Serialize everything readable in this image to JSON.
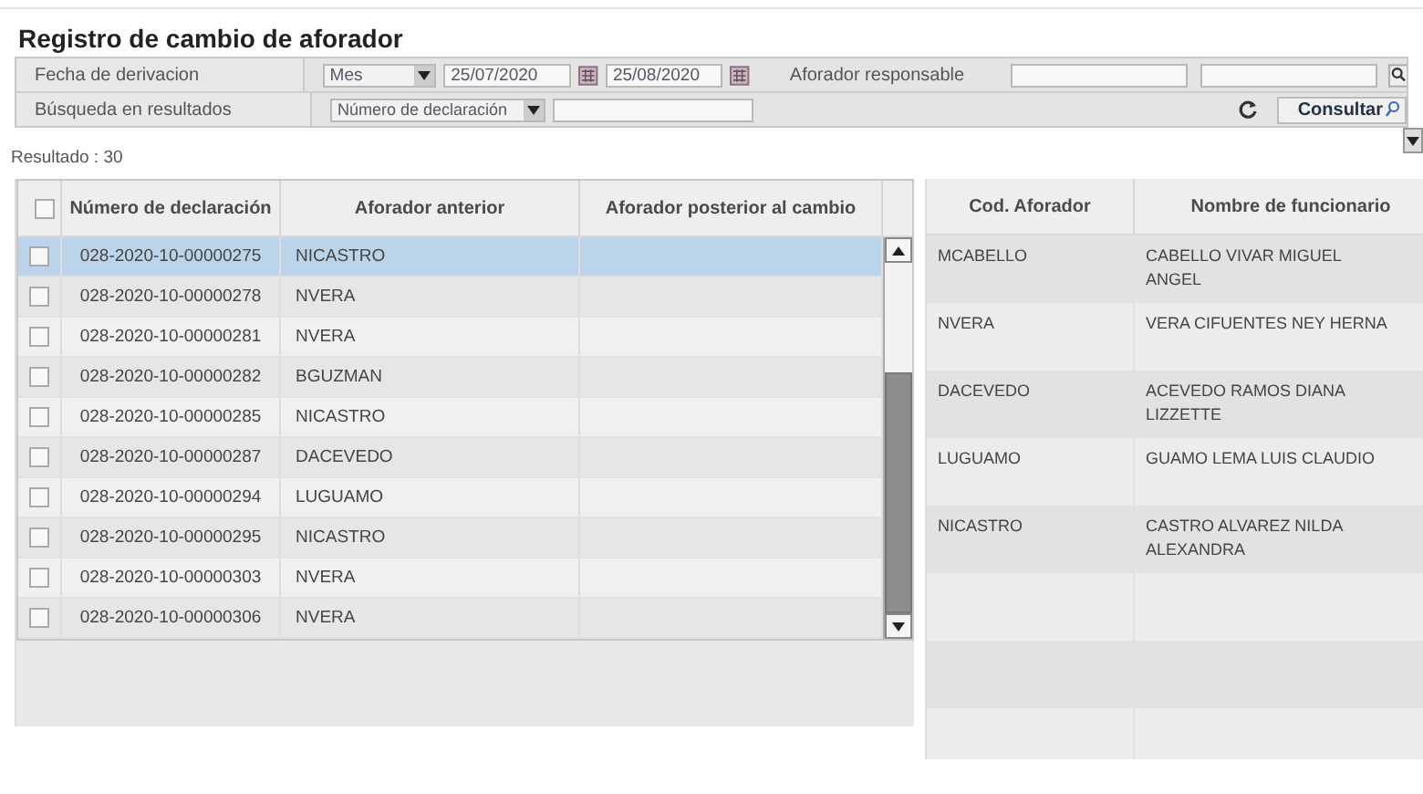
{
  "title": "Registro de cambio de aforador",
  "filters": {
    "date_label": "Fecha de derivacion",
    "period": "Mes",
    "date_from": "25/07/2020",
    "date_to": "25/08/2020",
    "officer_label": "Aforador responsable",
    "search_label": "Búsqueda en resultados",
    "search_field": "Número de declaración",
    "consult_button": "Consultar"
  },
  "result_count": "Resultado : 30",
  "declarations": {
    "select_all_checked": false,
    "columns": [
      "Número de declaración",
      "Aforador anterior",
      "Aforador posterior al cambio"
    ],
    "rows": [
      {
        "number": "028-2020-10-00000275",
        "previous": "NICASTRO",
        "selected": true,
        "checked": false
      },
      {
        "number": "028-2020-10-00000278",
        "previous": "NVERA",
        "selected": false,
        "checked": false
      },
      {
        "number": "028-2020-10-00000281",
        "previous": "NVERA",
        "selected": false,
        "checked": false
      },
      {
        "number": "028-2020-10-00000282",
        "previous": "BGUZMAN",
        "selected": false,
        "checked": false
      },
      {
        "number": "028-2020-10-00000285",
        "previous": "NICASTRO",
        "selected": false,
        "checked": false
      },
      {
        "number": "028-2020-10-00000287",
        "previous": "DACEVEDO",
        "selected": false,
        "checked": false
      },
      {
        "number": "028-2020-10-00000294",
        "previous": "LUGUAMO",
        "selected": false,
        "checked": false
      },
      {
        "number": "028-2020-10-00000295",
        "previous": "NICASTRO",
        "selected": false,
        "checked": false
      },
      {
        "number": "028-2020-10-00000303",
        "previous": "NVERA",
        "selected": false,
        "checked": false
      },
      {
        "number": "028-2020-10-00000306",
        "previous": "NVERA",
        "selected": false,
        "checked": false
      }
    ]
  },
  "officers": {
    "columns": [
      "Cod. Aforador",
      "Nombre de funcionario"
    ],
    "rows": [
      {
        "code": "MCABELLO",
        "name": "CABELLO VIVAR MIGUEL ANGEL"
      },
      {
        "code": "NVERA",
        "name": "VERA CIFUENTES NEY HERNA"
      },
      {
        "code": "DACEVEDO",
        "name": "ACEVEDO RAMOS DIANA LIZZETTE"
      },
      {
        "code": "LUGUAMO",
        "name": "GUAMO LEMA LUIS CLAUDIO"
      },
      {
        "code": "NICASTRO",
        "name": "CASTRO ALVAREZ NILDA ALEXANDRA"
      }
    ]
  }
}
